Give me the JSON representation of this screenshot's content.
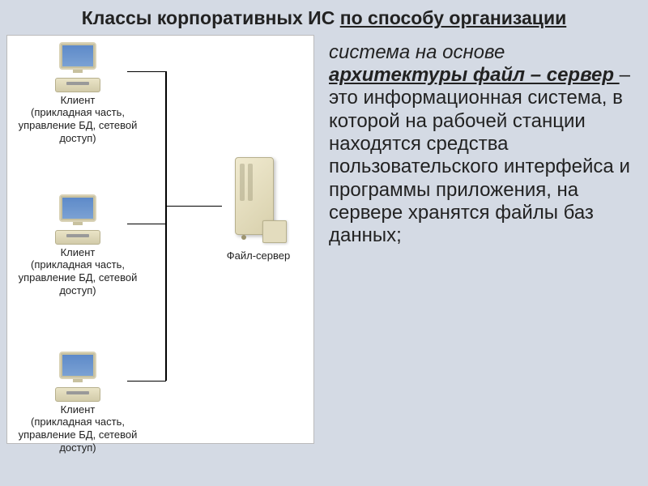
{
  "title": {
    "plain": "Классы корпоративных ИС ",
    "underlined": "по способу организации"
  },
  "diagram": {
    "clients": [
      {
        "name": "Клиент",
        "detail": "(прикладная часть, управление БД, сетевой доступ)"
      },
      {
        "name": "Клиент",
        "detail": "(прикладная часть, управление БД, сетевой доступ)"
      },
      {
        "name": "Клиент",
        "detail": "(прикладная часть, управление БД, сетевой доступ)"
      }
    ],
    "server": {
      "label": "Файл-сервер"
    }
  },
  "body": {
    "lead": "система на основе ",
    "arch": "архитектуры файл – сервер ",
    "rest": "– это информационная система, в которой на рабочей станции находятся средства пользовательского интерфейса и программы приложения, на сервере хранятся файлы баз данных;"
  }
}
